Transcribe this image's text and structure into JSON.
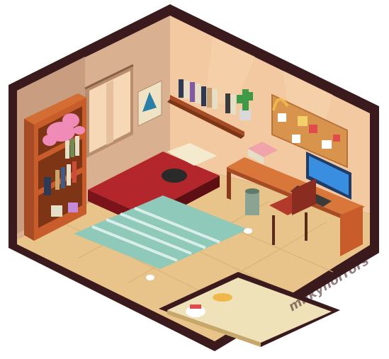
{
  "scene": {
    "kind": "isometric pixel-art bedroom",
    "watermark": "milkyhorrors"
  },
  "palette": {
    "outline": "#3b1a1d",
    "wall_left": "#d8b08f",
    "wall_right": "#f0c8a0",
    "floor": "#e9c48a",
    "rug": "#8ec9ba",
    "bed": "#b3262b",
    "wood": "#c8672e",
    "monitor": "#2f7fd6"
  },
  "objects": {
    "window": "window",
    "poster": "triangle-poster",
    "bookshelf": "bookshelf",
    "plush": "pink-plush-toy",
    "wall_shelf": "wall-book-shelf",
    "cactus": "potted-cactus",
    "corkboard": "cork-board",
    "headphones": "headphones",
    "desk": "wooden-desk",
    "computer": "desktop-computer",
    "chair": "desk-chair",
    "trash": "trash-bin",
    "bed": "bed",
    "cat": "sleeping-black-cat",
    "rug": "striped-rug",
    "slippers": "slippers",
    "shoes": "shoes",
    "stairs": "stair-opening"
  }
}
